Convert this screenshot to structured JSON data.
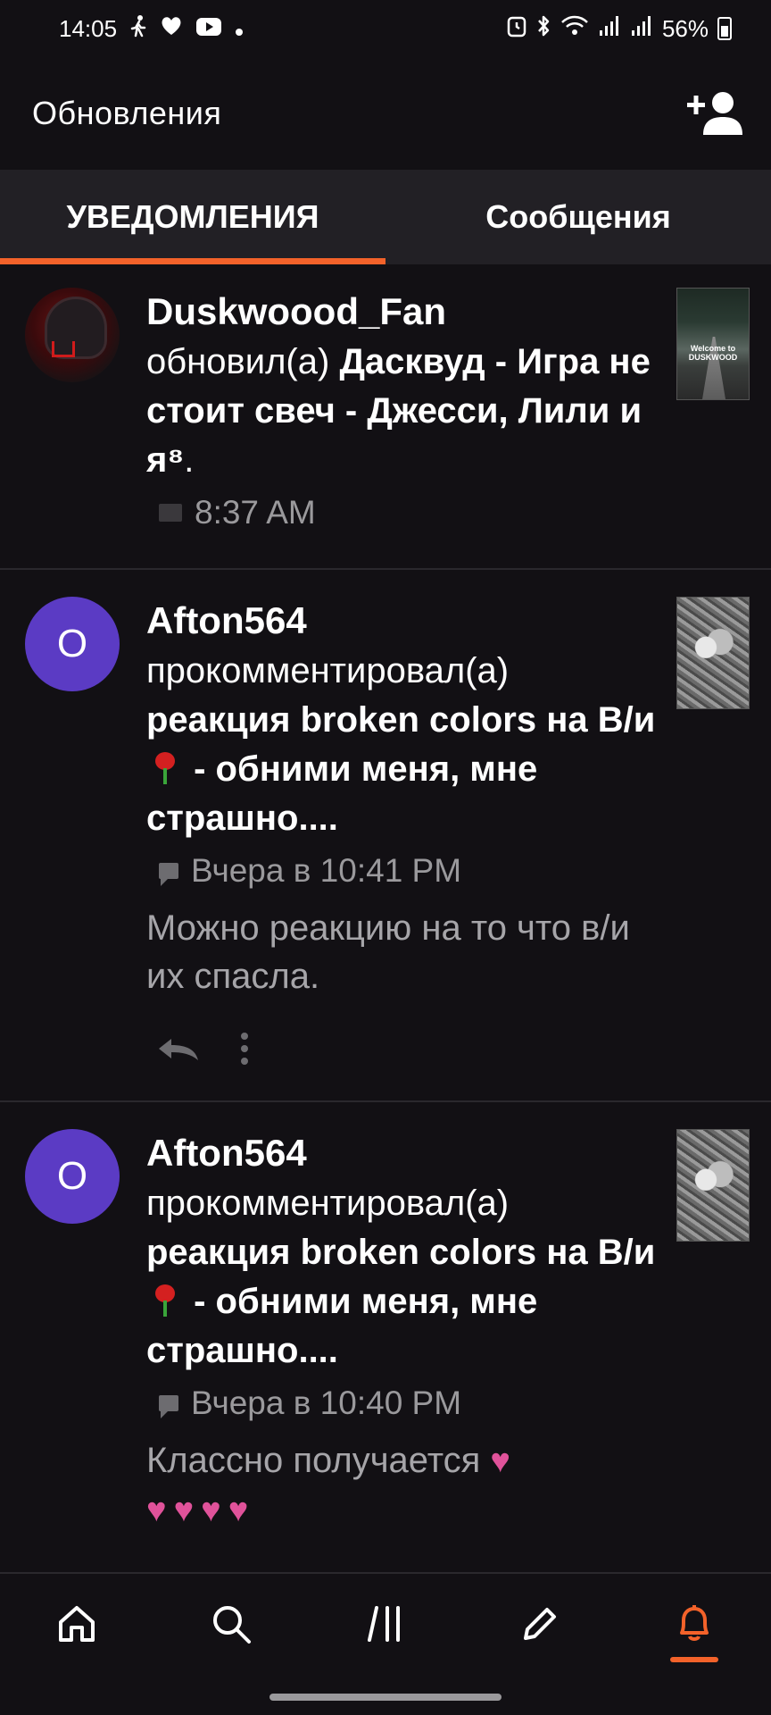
{
  "status_bar": {
    "time": "14:05",
    "battery": "56%",
    "icons": [
      "walking-icon",
      "heart-icon",
      "youtube-icon",
      "dot-icon",
      "alarm-icon",
      "bluetooth-icon",
      "wifi-icon",
      "signal-icon",
      "signal-icon",
      "battery-icon"
    ]
  },
  "app_bar": {
    "title": "Обновления",
    "add_user_icon": "add-user-icon"
  },
  "tabs": [
    {
      "label": "УВЕДОМЛЕНИЯ",
      "active": true
    },
    {
      "label": "Сообщения",
      "active": false
    }
  ],
  "notifications": [
    {
      "user": "Duskwoood_Fan",
      "action": "обновил(а)",
      "title": "Дасквуд - Игра не стоит свеч - Джесси, Лили и я⁸",
      "title_suffix": ".",
      "meta_icon": "book-icon",
      "time": "8:37 AM",
      "thumb_text": "Welcome to DUSKWOOD"
    },
    {
      "avatar_letter": "O",
      "user": "Afton564",
      "action": "прокомментировал(а)",
      "title_a": "реакция broken colors на В/и",
      "title_b": " - обними меня, мне страшно....",
      "meta_icon": "comment-icon",
      "time": "Вчера в 10:41 PM",
      "comment": "Можно реакцию на то что в/и их спасла."
    },
    {
      "avatar_letter": "O",
      "user": "Afton564",
      "action": "прокомментировал(а)",
      "title_a": "реакция broken colors на В/и",
      "title_b": " - обними меня, мне страшно....",
      "meta_icon": "comment-icon",
      "time": "Вчера в 10:40 PM",
      "comment": "Классно получается "
    }
  ],
  "bottom_nav": [
    {
      "icon": "home-icon",
      "active": false
    },
    {
      "icon": "search-icon",
      "active": false
    },
    {
      "icon": "library-icon",
      "active": false
    },
    {
      "icon": "write-icon",
      "active": false
    },
    {
      "icon": "bell-icon",
      "active": true
    }
  ],
  "colors": {
    "accent": "#f3622a",
    "background": "#121014",
    "tab_bar": "#222025",
    "avatar": "#5b3bc4",
    "muted_text": "#9a999c"
  }
}
